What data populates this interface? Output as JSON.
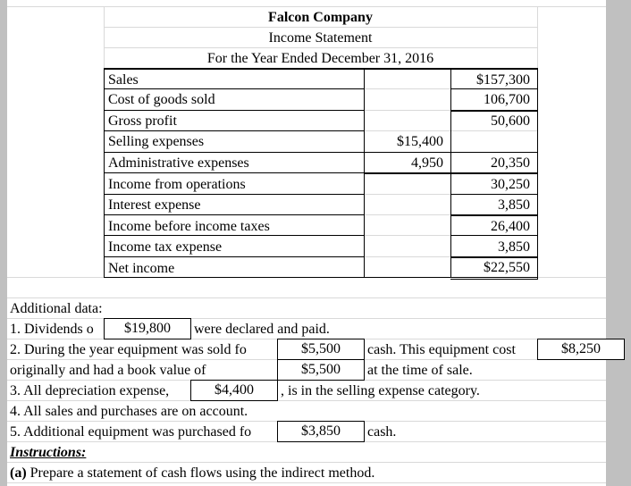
{
  "statement": {
    "company": "Falcon Company",
    "title": "Income Statement",
    "period": "For the Year Ended December 31, 2016",
    "rows": [
      {
        "label": "Sales",
        "col1": "",
        "col2": "$157,300"
      },
      {
        "label": "Cost of goods sold",
        "col1": "",
        "col2": "106,700"
      },
      {
        "label": "Gross profit",
        "col1": "",
        "col2": "50,600"
      },
      {
        "label": "Selling expenses",
        "col1": "$15,400",
        "col2": ""
      },
      {
        "label": "Administrative expenses",
        "col1": "4,950",
        "col2": "20,350"
      },
      {
        "label": "Income from operations",
        "col1": "",
        "col2": "30,250"
      },
      {
        "label": "Interest expense",
        "col1": "",
        "col2": "3,850"
      },
      {
        "label": "Income before income taxes",
        "col1": "",
        "col2": "26,400"
      },
      {
        "label": "Income tax expense",
        "col1": "",
        "col2": "3,850"
      },
      {
        "label": "Net income",
        "col1": "",
        "col2": "$22,550"
      }
    ]
  },
  "additional": {
    "heading": "Additional data:",
    "item1": {
      "pre": "1. Dividends o",
      "value": "$19,800",
      "post": "were declared and paid."
    },
    "item2": {
      "pre": "2. During the year equipment was sold fo",
      "value": "$5,500",
      "mid": "cash. This equipment cost",
      "cost": "$8,250"
    },
    "item2b": {
      "pre": "originally and had a book value of",
      "value": "$5,500",
      "post": "at the time of sale."
    },
    "item3": {
      "pre": "3. All depreciation expense,",
      "value": "$4,400",
      "post": ", is in the selling expense category."
    },
    "item4": {
      "text": "4. All sales and purchases are on account."
    },
    "item5": {
      "pre": "5. Additional equipment was purchased fo",
      "value": "$3,850",
      "post": "cash."
    },
    "instructions_heading": "Instructions:",
    "instruction_a_label": "(a)",
    "instruction_a_text": " Prepare a statement of cash flows using the indirect method."
  }
}
